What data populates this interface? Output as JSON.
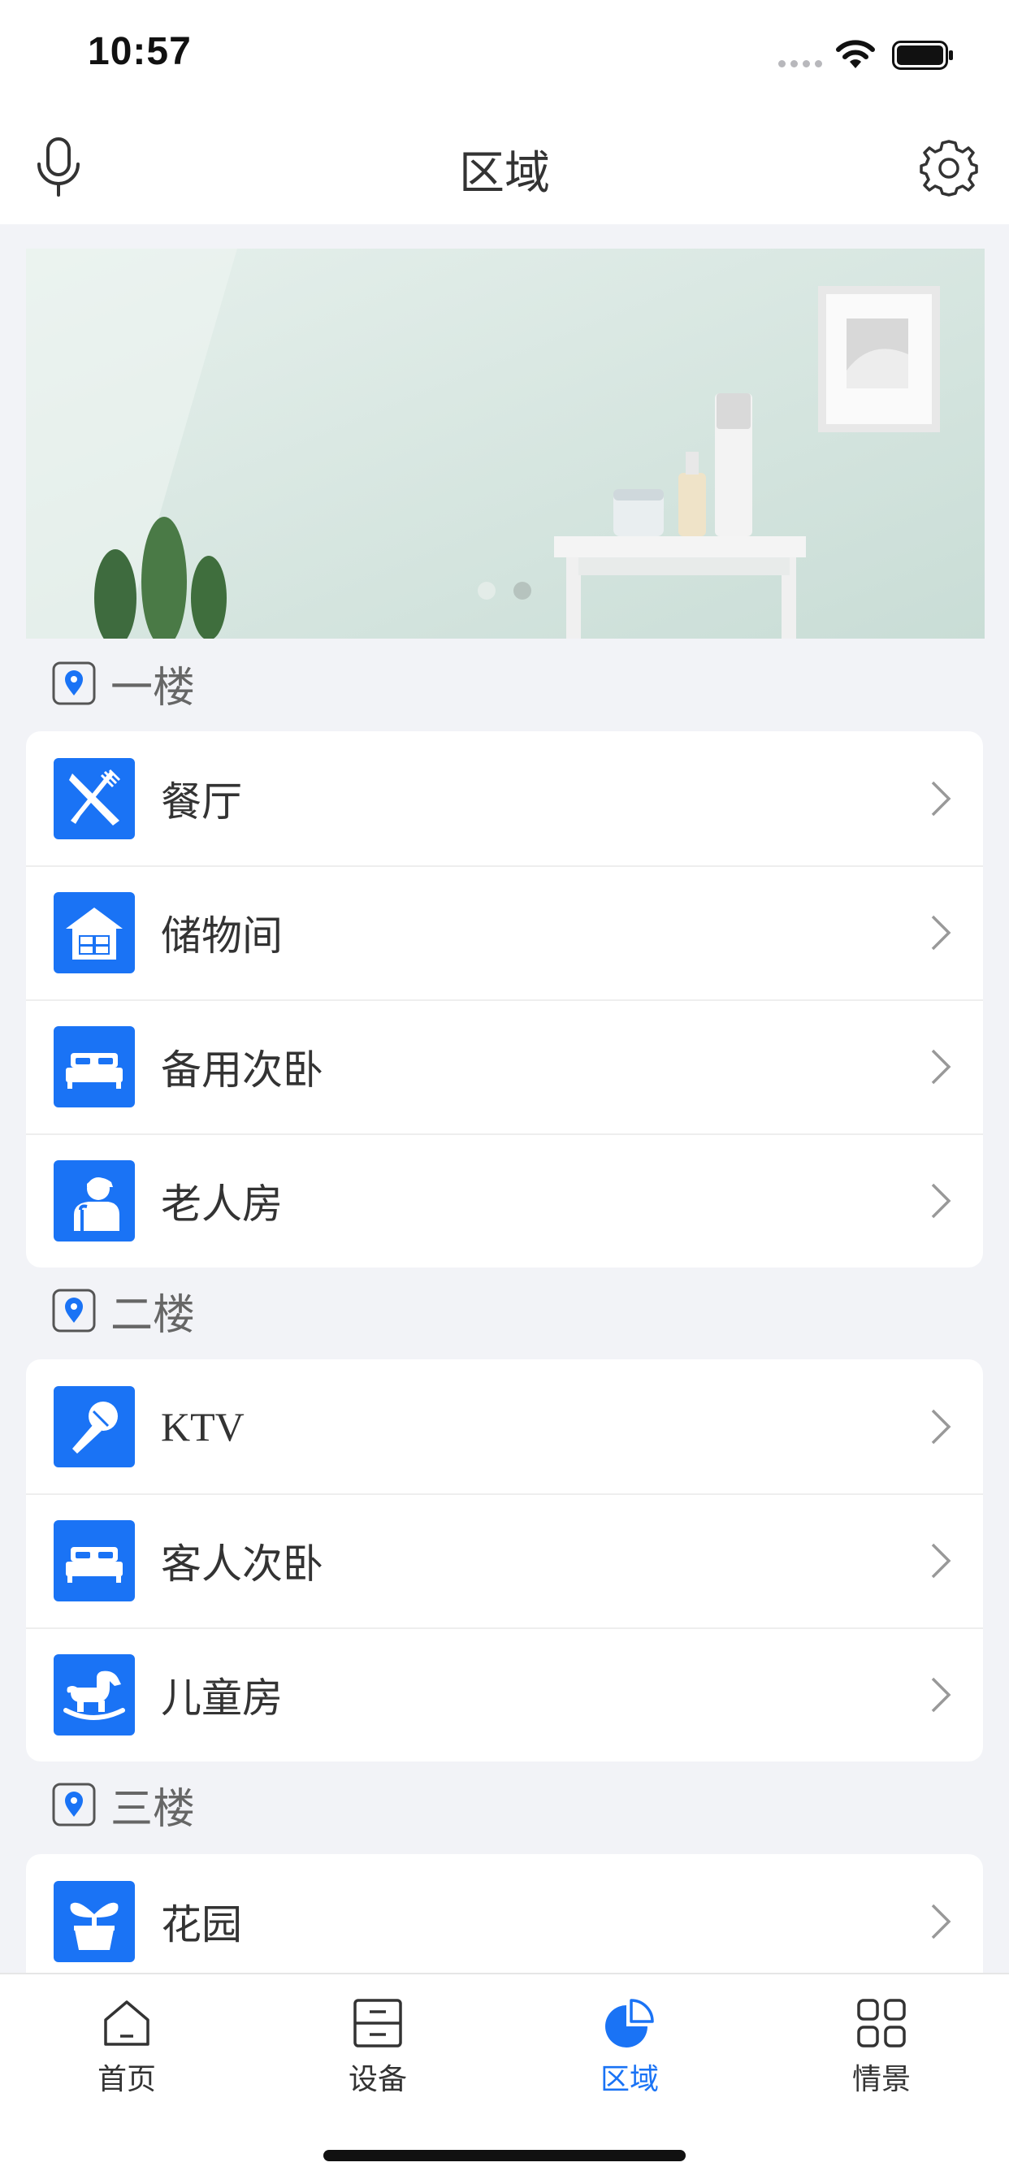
{
  "status": {
    "time": "10:57"
  },
  "nav": {
    "title": "区域"
  },
  "banner": {
    "dots": 2,
    "active_dot": 2
  },
  "floors": [
    {
      "name": "一楼",
      "rooms": [
        {
          "label": "餐厅",
          "icon": "dining-icon"
        },
        {
          "label": "储物间",
          "icon": "storage-icon"
        },
        {
          "label": "备用次卧",
          "icon": "bed-icon"
        },
        {
          "label": "老人房",
          "icon": "elder-icon"
        }
      ]
    },
    {
      "name": "二楼",
      "rooms": [
        {
          "label": "KTV",
          "icon": "microphone-icon"
        },
        {
          "label": "客人次卧",
          "icon": "bed-icon"
        },
        {
          "label": "儿童房",
          "icon": "rocking-horse-icon"
        }
      ]
    },
    {
      "name": "三楼",
      "rooms": [
        {
          "label": "花园",
          "icon": "flower-pot-icon"
        }
      ]
    }
  ],
  "tabs": [
    {
      "label": "首页",
      "icon": "home-icon",
      "active": false
    },
    {
      "label": "设备",
      "icon": "device-icon",
      "active": false
    },
    {
      "label": "区域",
      "icon": "area-icon",
      "active": true
    },
    {
      "label": "情景",
      "icon": "scene-icon",
      "active": false
    }
  ],
  "colors": {
    "accent": "#1A73F5",
    "background": "#F2F3F7",
    "text": "#333333"
  }
}
